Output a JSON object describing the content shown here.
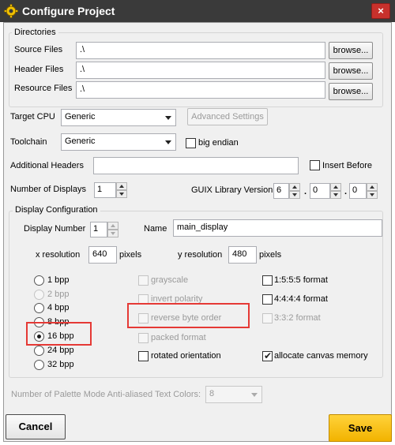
{
  "window": {
    "title": "Configure Project",
    "close_glyph": "×"
  },
  "directories": {
    "group_title": "Directories",
    "source_label": "Source Files",
    "source_value": ".\\",
    "header_label": "Header Files",
    "header_value": ".\\",
    "resource_label": "Resource Files",
    "resource_value": ".\\",
    "browse_label": "browse..."
  },
  "target": {
    "cpu_label": "Target CPU",
    "cpu_value": "Generic",
    "advanced_label": "Advanced Settings",
    "toolchain_label": "Toolchain",
    "toolchain_value": "Generic",
    "big_endian_label": "big endian",
    "additional_headers_label": "Additional Headers",
    "additional_headers_value": "",
    "insert_before_label": "Insert Before",
    "num_displays_label": "Number of Displays",
    "num_displays_value": "1",
    "guix_label": "GUIX Library Version",
    "guix_major": "6",
    "guix_minor": "0",
    "guix_patch": "0",
    "dot": "."
  },
  "display_config": {
    "group_title": "Display Configuration",
    "display_number_label": "Display Number",
    "display_number_value": "1",
    "name_label": "Name",
    "name_value": "main_display",
    "x_res_label": "x resolution",
    "x_res_value": "640",
    "x_res_unit": "pixels",
    "y_res_label": "y resolution",
    "y_res_value": "480",
    "y_res_unit": "pixels",
    "bpp_options": [
      "1 bpp",
      "2 bpp",
      "4 bpp",
      "8 bpp",
      "16 bpp",
      "24 bpp",
      "32 bpp"
    ],
    "bpp_selected": "16 bpp",
    "opt_grayscale": "grayscale",
    "opt_invert": "invert polarity",
    "opt_reverse": "reverse byte order",
    "opt_packed": "packed format",
    "opt_rotated": "rotated orientation",
    "fmt_1555": "1:5:5:5 format",
    "fmt_4444": "4:4:4:4 format",
    "fmt_332": "3:3:2 format",
    "opt_allocate": "allocate canvas memory",
    "allocate_checked": true,
    "palette_label": "Number of Palette Mode Anti-aliased Text Colors:",
    "palette_value": "8"
  },
  "footer": {
    "cancel_label": "Cancel",
    "save_label": "Save"
  },
  "colors": {
    "save_accent": "#f2b300",
    "highlight": "#e53935",
    "titlebar": "#3a3a3a"
  },
  "icons": {
    "app": "gear-icon",
    "close": "close-icon"
  }
}
